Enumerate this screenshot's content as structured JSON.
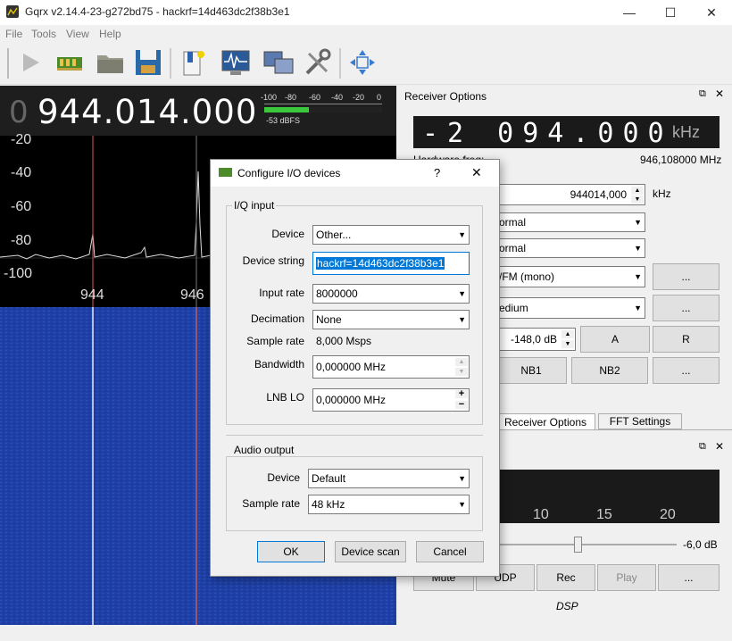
{
  "window": {
    "title": "Gqrx v2.14.4-23-g272bd75 - hackrf=14d463dc2f38b3e1",
    "minimize": "—",
    "maximize": "☐",
    "close": "✕"
  },
  "menu": [
    "File",
    "Tools",
    "View",
    "Help"
  ],
  "freq_display": {
    "leading": "0",
    "value": "944.014.000"
  },
  "meter": {
    "ticks": [
      "-100",
      "-80",
      "-60",
      "-40",
      "-20",
      "0"
    ],
    "readout": "-53 dBFS",
    "level_fraction": 0.38
  },
  "spectrum": {
    "y_ticks": [
      "-20",
      "-40",
      "-60",
      "-80",
      "-100"
    ],
    "x_ticks": [
      "944",
      "946"
    ]
  },
  "receiver": {
    "panel_title": "Receiver Options",
    "offset_value": "-2 094.000",
    "offset_unit": "kHz",
    "hw_freq_label": "Hardware freq:",
    "hw_freq_value": "946,108000 MHz",
    "freq_input": "944014,000",
    "freq_unit": "kHz",
    "combo1": "ormal",
    "combo2": "ormal",
    "mode": "/FM (mono)",
    "agc": "edium",
    "more": "...",
    "squelch": "-148,0 dB",
    "btn_a": "A",
    "btn_r": "R",
    "nb1": "NB1",
    "nb2": "NB2"
  },
  "tabs": [
    "Receiver Options",
    "FFT Settings"
  ],
  "audio": {
    "ticks": [
      "10",
      "15",
      "20"
    ],
    "gain": "-6,0 dB",
    "buttons": [
      "Mute",
      "UDP",
      "Rec",
      "Play",
      "..."
    ],
    "dsp": "DSP"
  },
  "dialog": {
    "title": "Configure I/O devices",
    "help": "?",
    "close": "✕",
    "iq_group": "I/Q input",
    "device_label": "Device",
    "device_value": "Other...",
    "device_string_label": "Device string",
    "device_string_value": "hackrf=14d463dc2f38b3e1",
    "input_rate_label": "Input rate",
    "input_rate_value": "8000000",
    "decimation_label": "Decimation",
    "decimation_value": "None",
    "sample_rate_label": "Sample rate",
    "sample_rate_value": "8,000 Msps",
    "bandwidth_label": "Bandwidth",
    "bandwidth_value": "0,000000 MHz",
    "lnb_label": "LNB LO",
    "lnb_value": "0,000000 MHz",
    "audio_group": "Audio output",
    "audio_device_label": "Device",
    "audio_device_value": "Default",
    "audio_rate_label": "Sample rate",
    "audio_rate_value": "48 kHz",
    "ok": "OK",
    "scan": "Device scan",
    "cancel": "Cancel"
  }
}
